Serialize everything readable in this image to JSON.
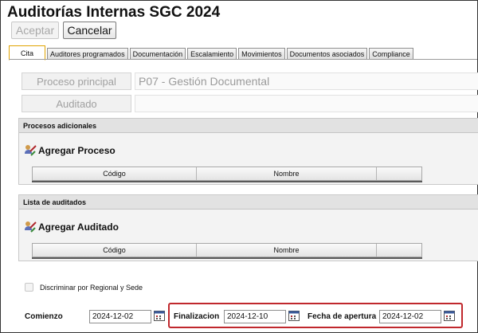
{
  "window": {
    "title": "Auditorías Internas SGC 2024"
  },
  "toolbar": {
    "accept_label": "Aceptar",
    "cancel_label": "Cancelar"
  },
  "tabs": [
    {
      "label": "Cita",
      "active": true
    },
    {
      "label": "Auditores programados"
    },
    {
      "label": "Documentación"
    },
    {
      "label": "Escalamiento"
    },
    {
      "label": "Movimientos"
    },
    {
      "label": "Documentos asociados"
    },
    {
      "label": "Compliance"
    }
  ],
  "form": {
    "process_button": "Proceso principal",
    "process_value": "P07 - Gestión Documental",
    "audited_button": "Auditado",
    "audited_value": ""
  },
  "processes_section": {
    "title": "Procesos adicionales",
    "add_label": "Agregar Proceso",
    "columns": [
      "Código",
      "Nombre"
    ]
  },
  "audited_section": {
    "title": "Lista de auditados",
    "add_label": "Agregar Auditado",
    "columns": [
      "Código",
      "Nombre"
    ]
  },
  "discriminate_label": "Discriminar por Regional y Sede",
  "dates": {
    "start_label": "Comienzo",
    "start_value": "2024-12-02",
    "end_label": "Finalizacion",
    "end_value": "2024-12-10",
    "open_label": "Fecha de apertura",
    "open_value": "2024-12-02"
  },
  "colors": {
    "active_tab_border": "#e0a300",
    "highlight_border": "#c0282d"
  }
}
